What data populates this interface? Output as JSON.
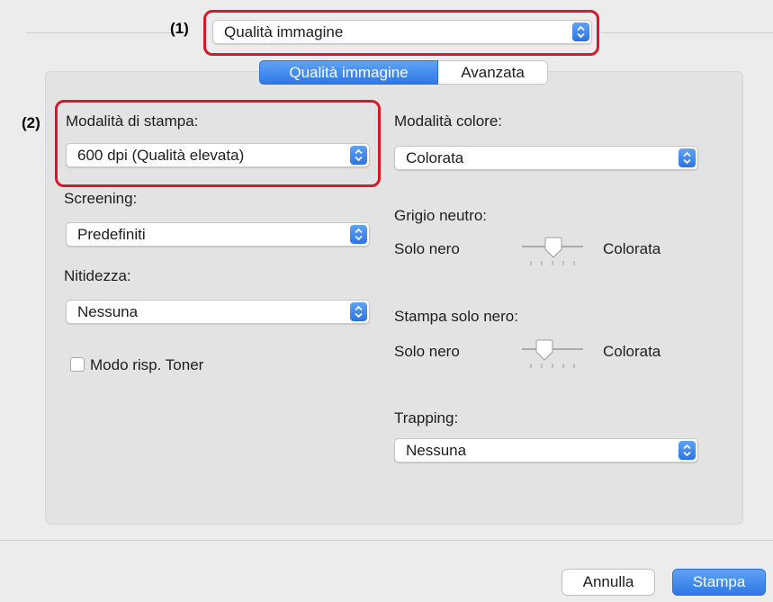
{
  "callouts": {
    "one": "(1)",
    "two": "(2)"
  },
  "top_popup": {
    "value": "Qualità immagine"
  },
  "tabs": [
    {
      "label": "Qualità immagine",
      "active": true
    },
    {
      "label": "Avanzata",
      "active": false
    }
  ],
  "left": {
    "print_mode": {
      "label": "Modalità di stampa:",
      "value": "600 dpi (Qualità elevata)"
    },
    "screening": {
      "label": "Screening:",
      "value": "Predefiniti"
    },
    "sharpness": {
      "label": "Nitidezza:",
      "value": "Nessuna"
    },
    "toner_save": {
      "label": "Modo risp. Toner",
      "checked": false
    }
  },
  "right": {
    "color_mode": {
      "label": "Modalità colore:",
      "value": "Colorata"
    },
    "neutral_gray": {
      "label": "Grigio neutro:",
      "min_label": "Solo nero",
      "max_label": "Colorata"
    },
    "black_only": {
      "label": "Stampa solo nero:",
      "min_label": "Solo nero",
      "max_label": "Colorata"
    },
    "trapping": {
      "label": "Trapping:",
      "value": "Nessuna"
    }
  },
  "buttons": {
    "cancel": "Annulla",
    "print": "Stampa"
  },
  "colors": {
    "accent": "#2f78e6",
    "callout": "#d7182a",
    "background": "#ececec"
  }
}
